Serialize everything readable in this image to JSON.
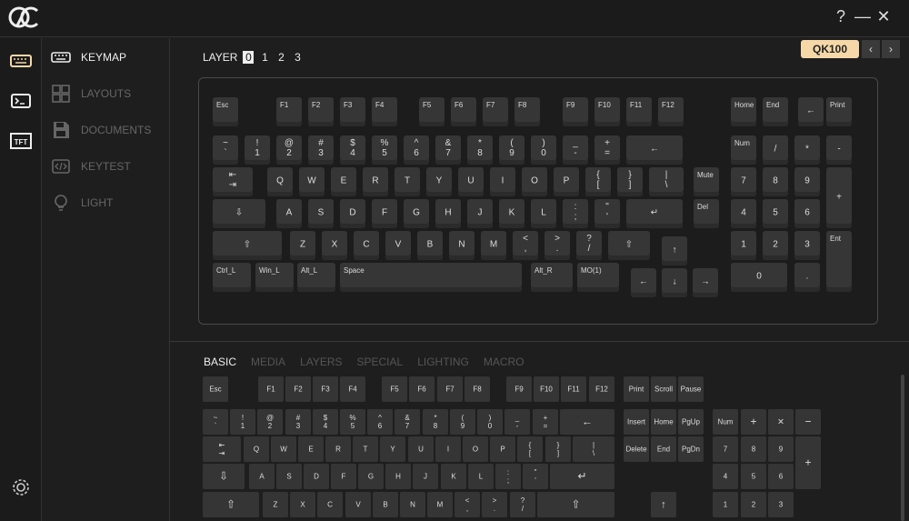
{
  "window": {
    "help": "?",
    "minimize": "—",
    "close": "✕"
  },
  "sidebar": {
    "items": [
      {
        "label": "KEYMAP",
        "icon": "keyboard-icon",
        "active": true
      },
      {
        "label": "LAYOUTS",
        "icon": "grid-icon",
        "active": false
      },
      {
        "label": "DOCUMENTS",
        "icon": "save-icon",
        "active": false
      },
      {
        "label": "KEYTEST",
        "icon": "code-icon",
        "active": false
      },
      {
        "label": "LIGHT",
        "icon": "bulb-icon",
        "active": false
      }
    ]
  },
  "rail": {
    "items": [
      "keyboard-icon",
      "terminal-icon",
      "tft-icon"
    ],
    "tft_label": "TFT",
    "settings": "gear-icon"
  },
  "layer": {
    "label": "LAYER",
    "options": [
      "0",
      "1",
      "2",
      "3"
    ],
    "selected": "0"
  },
  "model": {
    "name": "QK100",
    "prev": "‹",
    "next": "›"
  },
  "keymap": {
    "rows": [
      [
        [
          "Esc"
        ],
        [
          "F1"
        ],
        [
          "F2"
        ],
        [
          "F3"
        ],
        [
          "F4"
        ],
        [
          "F5"
        ],
        [
          "F6"
        ],
        [
          "F7"
        ],
        [
          "F8"
        ],
        [
          "F9"
        ],
        [
          "F10"
        ],
        [
          "F11"
        ],
        [
          "F12"
        ],
        [
          "Home"
        ],
        [
          "End"
        ],
        [
          "←"
        ],
        [
          "Print"
        ]
      ],
      [
        [
          "~\n`"
        ],
        [
          "!\n1"
        ],
        [
          "@\n2"
        ],
        [
          "#\n3"
        ],
        [
          "$\n4"
        ],
        [
          "%\n5"
        ],
        [
          "^\n6"
        ],
        [
          "&\n7"
        ],
        [
          "*\n8"
        ],
        [
          "(\n9"
        ],
        [
          ")\n0"
        ],
        [
          "_\n-"
        ],
        [
          "+\n="
        ],
        [
          "←"
        ],
        [
          "Num"
        ],
        [
          "/"
        ],
        [
          "*"
        ],
        [
          "-"
        ]
      ],
      [
        [
          "⇤\n⇥"
        ],
        [
          "Q"
        ],
        [
          "W"
        ],
        [
          "E"
        ],
        [
          "R"
        ],
        [
          "T"
        ],
        [
          "Y"
        ],
        [
          "U"
        ],
        [
          "I"
        ],
        [
          "O"
        ],
        [
          "P"
        ],
        [
          "{\n["
        ],
        [
          "}\n]"
        ],
        [
          "|\n\\"
        ],
        [
          "Mute"
        ],
        [
          "7"
        ],
        [
          "8"
        ],
        [
          "9"
        ],
        [
          "+"
        ]
      ],
      [
        [
          "⇩"
        ],
        [
          "A"
        ],
        [
          "S"
        ],
        [
          "D"
        ],
        [
          "F"
        ],
        [
          "G"
        ],
        [
          "H"
        ],
        [
          "J"
        ],
        [
          "K"
        ],
        [
          "L"
        ],
        [
          ":\n;"
        ],
        [
          "\"\n'"
        ],
        [
          "↵"
        ],
        [
          "Del"
        ],
        [
          "4"
        ],
        [
          "5"
        ],
        [
          "6"
        ]
      ],
      [
        [
          "⇧"
        ],
        [
          "Z"
        ],
        [
          "X"
        ],
        [
          "C"
        ],
        [
          "V"
        ],
        [
          "B"
        ],
        [
          "N"
        ],
        [
          "M"
        ],
        [
          "<\n,"
        ],
        [
          ">\n."
        ],
        [
          "?\n/"
        ],
        [
          "⇧"
        ],
        [
          "↑"
        ],
        [
          "1"
        ],
        [
          "2"
        ],
        [
          "3"
        ],
        [
          "Ent"
        ]
      ],
      [
        [
          "Ctrl_L"
        ],
        [
          "Win_L"
        ],
        [
          "Alt_L"
        ],
        [
          "Space"
        ],
        [
          "Alt_R"
        ],
        [
          "MO(1)"
        ],
        [
          "←"
        ],
        [
          "↓"
        ],
        [
          "→"
        ],
        [
          "0"
        ],
        [
          "."
        ]
      ]
    ]
  },
  "tabs": {
    "items": [
      "BASIC",
      "MEDIA",
      "LAYERS",
      "SPECIAL",
      "LIGHTING",
      "MACRO"
    ],
    "active": "BASIC"
  },
  "basic": {
    "rows": [
      [
        "Esc",
        "F1",
        "F2",
        "F3",
        "F4",
        "F5",
        "F6",
        "F7",
        "F8",
        "F9",
        "F10",
        "F11",
        "F12",
        "Print",
        "Scroll",
        "Pause"
      ],
      [
        "~\n`",
        "!\n1",
        "@\n2",
        "#\n3",
        "$\n4",
        "%\n5",
        "^\n6",
        "&\n7",
        "*\n8",
        "(\n9",
        ")\n0",
        "_\n-",
        "+\n=",
        "←",
        "Insert",
        "Home",
        "PgUp",
        "Num",
        "+",
        "×",
        "−"
      ],
      [
        "⇤\n⇥",
        "Q",
        "W",
        "E",
        "R",
        "T",
        "Y",
        "U",
        "I",
        "O",
        "P",
        "{\n[",
        "}\n]",
        "|\n\\",
        "Delete",
        "End",
        "PgDn",
        "7",
        "8",
        "9",
        "+"
      ],
      [
        "⇩",
        "A",
        "S",
        "D",
        "F",
        "G",
        "H",
        "J",
        "K",
        "L",
        ":\n;",
        "\"\n'",
        "↵",
        "4",
        "5",
        "6"
      ],
      [
        "⇧",
        "Z",
        "X",
        "C",
        "V",
        "B",
        "N",
        "M",
        "<\n,",
        ">\n.",
        "?\n/",
        "⇧",
        "↑",
        "1",
        "2",
        "3"
      ]
    ]
  }
}
